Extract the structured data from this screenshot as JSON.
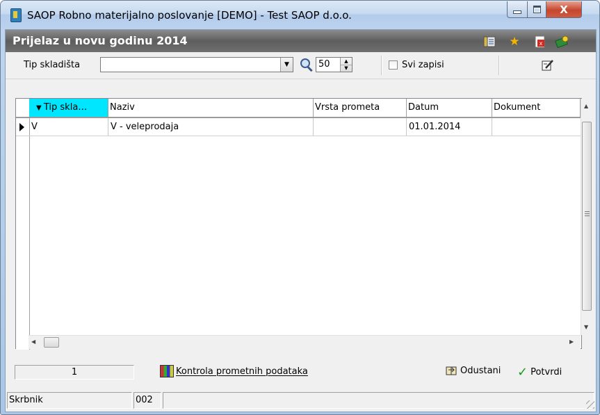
{
  "window": {
    "title": "SAOP Robno materijalno poslovanje [DEMO] - Test SAOP d.o.o.",
    "close_glyph": "X"
  },
  "header": {
    "title": "Prijelaz u novu godinu 2014",
    "icons": [
      "columns-icon",
      "favorite-star-icon",
      "pdf-export-icon",
      "help-book-icon"
    ]
  },
  "toolbar": {
    "tip_label": "Tip skladišta",
    "tip_value": "",
    "records_value": "50",
    "all_records_label": "Svi zapisi",
    "all_records_checked": false
  },
  "grid": {
    "columns": [
      "Tip skla…",
      "Naziv",
      "Vrsta prometa",
      "Datum",
      "Dokument"
    ],
    "sorted_column": "Tip skla…",
    "rows": [
      {
        "tip": "V",
        "naziv": "V - veleprodaja",
        "vrsta": "",
        "datum": "01.01.2014",
        "dokument": ""
      }
    ]
  },
  "bottom": {
    "record_count": "1",
    "kontrola_label": "Kontrola prometnih podataka",
    "odustani_label": "Odustani",
    "potvrdi_label": "Potvrdi"
  },
  "status": {
    "role": "Skrbnik",
    "code": "002",
    "message": ""
  }
}
